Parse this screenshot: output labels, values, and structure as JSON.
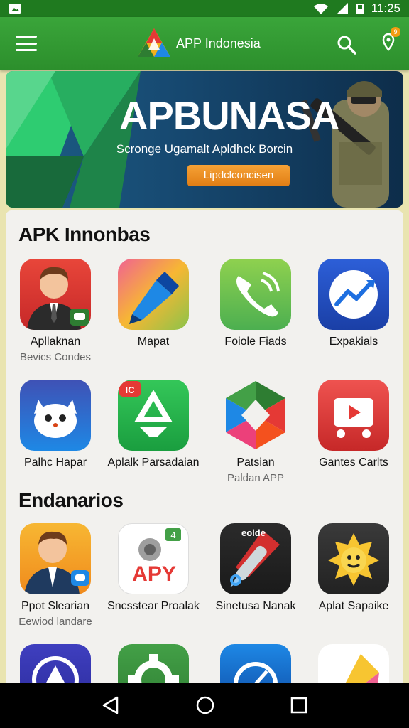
{
  "status_bar": {
    "time": "11:25"
  },
  "app_bar": {
    "title": "APP Indonesia",
    "notification_count": "9"
  },
  "banner": {
    "title": "APBUNASA",
    "subtitle": "Scronge Ugamalt Apldhck Borcin",
    "button_label": "Lipdclconcisen"
  },
  "sections": [
    {
      "title": "APK Innonbas",
      "apps": [
        {
          "name": "Apllaknan",
          "sub": "Bevics Condes",
          "icon": "businessman-icon"
        },
        {
          "name": "Mapat",
          "sub": "",
          "icon": "pen-nib-icon"
        },
        {
          "name": "Foiole Fiads",
          "sub": "",
          "icon": "phone-icon"
        },
        {
          "name": "Expakials",
          "sub": "",
          "icon": "trend-chart-icon"
        },
        {
          "name": "Palhc Hapar",
          "sub": "",
          "icon": "cat-icon"
        },
        {
          "name": "Aplalk Parsadaian",
          "sub": "",
          "icon": "recycle-icon"
        },
        {
          "name": "Patsian",
          "sub": "Paldan APP",
          "icon": "colorful-hexagon-icon"
        },
        {
          "name": "Gantes Carlts",
          "sub": "",
          "icon": "video-cart-icon"
        }
      ]
    },
    {
      "title": "Endanarios",
      "apps": [
        {
          "name": "Ppot Slearian",
          "sub": "Eewiod landare",
          "icon": "businessman-chat-icon"
        },
        {
          "name": "Sncsstear Proalak",
          "sub": "",
          "icon": "apy-icon"
        },
        {
          "name": "Sinetusa Nanak",
          "sub": "",
          "icon": "syringe-icon"
        },
        {
          "name": "Aplat Sapaike",
          "sub": "",
          "icon": "sun-face-icon"
        }
      ]
    }
  ],
  "section1_label_icon": "IC",
  "apy_icon_text": "APY",
  "apy_badge_text": "4",
  "syringe_badge_text": "eolde",
  "colors": {
    "status_bar": "#1f7a1f",
    "app_bar": "#2c8f2c",
    "accent_orange": "#f08a1c",
    "background": "#f2f1ee"
  }
}
